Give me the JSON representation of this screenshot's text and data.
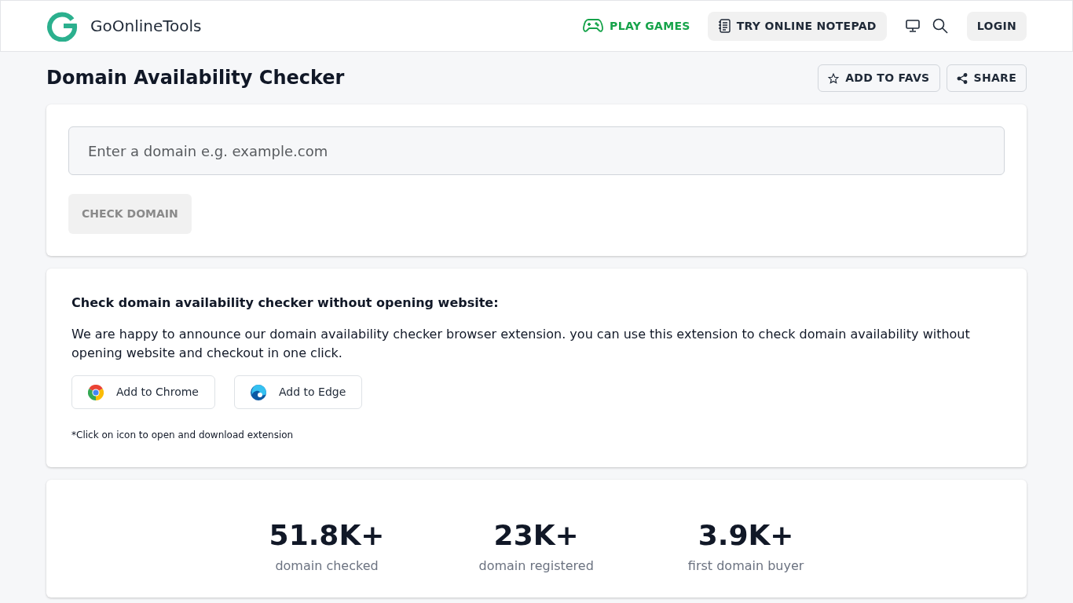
{
  "header": {
    "brand": "GoOnlineTools",
    "nav": [
      {
        "label": "PLAY GAMES",
        "kind": "games"
      },
      {
        "label": "TRY ONLINE NOTEPAD",
        "kind": "notepad"
      }
    ],
    "login": "LOGIN"
  },
  "page": {
    "title": "Domain Availability Checker",
    "actions": [
      {
        "label": "ADD TO FAVS",
        "kind": "star"
      },
      {
        "label": "SHARE",
        "kind": "share"
      }
    ]
  },
  "checker": {
    "placeholder": "Enter a domain e.g. example.com",
    "button": {
      "label": "CHECK DOMAIN",
      "disabled": true
    }
  },
  "extension": {
    "heading": "Check domain availability checker without opening website:",
    "text": "We are happy to announce our domain availability checker browser extension. you can use this extension to check domain availability without opening website and checkout in one click.",
    "buttons": [
      {
        "label": "Add to Chrome",
        "kind": "chrome"
      },
      {
        "label": "Add to Edge",
        "kind": "edge"
      }
    ],
    "note": "*Click on icon to open and download extension"
  },
  "stats": [
    {
      "value": "51.8K+",
      "label": "domain checked"
    },
    {
      "value": "23K+",
      "label": "domain registered"
    },
    {
      "value": "3.9K+",
      "label": "first domain buyer"
    }
  ]
}
